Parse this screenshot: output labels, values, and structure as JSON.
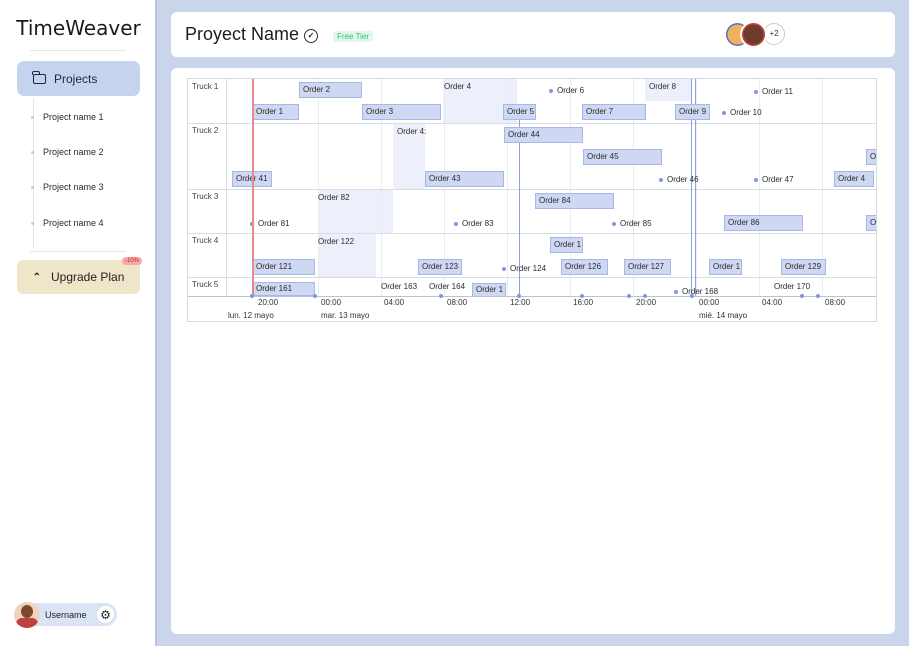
{
  "sidebar": {
    "brand": "TimeWeaver",
    "nav_projects": "Projects",
    "projects": [
      "Project name 1",
      "Project name 2",
      "Project name 3",
      "Project name 4"
    ],
    "upgrade_label": "Upgrade Plan",
    "upgrade_badge": "-10%",
    "username": "Username",
    "icons": {
      "folder": "folder-icon",
      "upgrade": "chevrons-up-icon",
      "gear": "gear-icon",
      "verify": "badge-check-icon"
    }
  },
  "header": {
    "title": "Proyect Name",
    "tier": "Free Tier",
    "more_members": "+2"
  },
  "timeline": {
    "trucks": [
      "Truck 1",
      "Truck 2",
      "Truck 3",
      "Truck 4",
      "Truck 5"
    ],
    "orders": {
      "o1": "Order 1",
      "o2": "Order 2",
      "o3": "Order 3",
      "o4": "Order 4",
      "o5": "Order 5",
      "o6": "Order 6",
      "o7": "Order 7",
      "o8": "Order 8",
      "o9": "Order 9",
      "o10": "Order 10",
      "o11": "Order 11",
      "o41": "Order 41",
      "o42": "Order 4:",
      "o43": "Order 43",
      "o44": "Order 44",
      "o45": "Order 45",
      "o46": "Order 46",
      "o47": "Order 47",
      "o48": "Order 4",
      "o49": "Or",
      "o81": "Order 81",
      "o82": "Order 82",
      "o83": "Order 83",
      "o84": "Order 84",
      "o85": "Order 85",
      "o86": "Order 86",
      "o87": "Or",
      "o121": "Order 121",
      "o122": "Order 122",
      "o123": "Order 123",
      "o124": "Order 124",
      "o125": "Order 1",
      "o126": "Order 126",
      "o127": "Order 127",
      "o128": "Order 1",
      "o129": "Order 129",
      "o161": "Order 161",
      "o163": "Order 163",
      "o164": "Order 164",
      "o165": "Order 1",
      "o168": "Order 168",
      "o170": "Order 170"
    },
    "ticks": [
      "20:00",
      "00:00",
      "04:00",
      "08:00",
      "12:00",
      "16:00",
      "20:00",
      "00:00",
      "04:00",
      "08:00"
    ],
    "dates": [
      "lun. 12 mayo",
      "mar. 13 mayo",
      "mié. 14 mayo"
    ]
  }
}
